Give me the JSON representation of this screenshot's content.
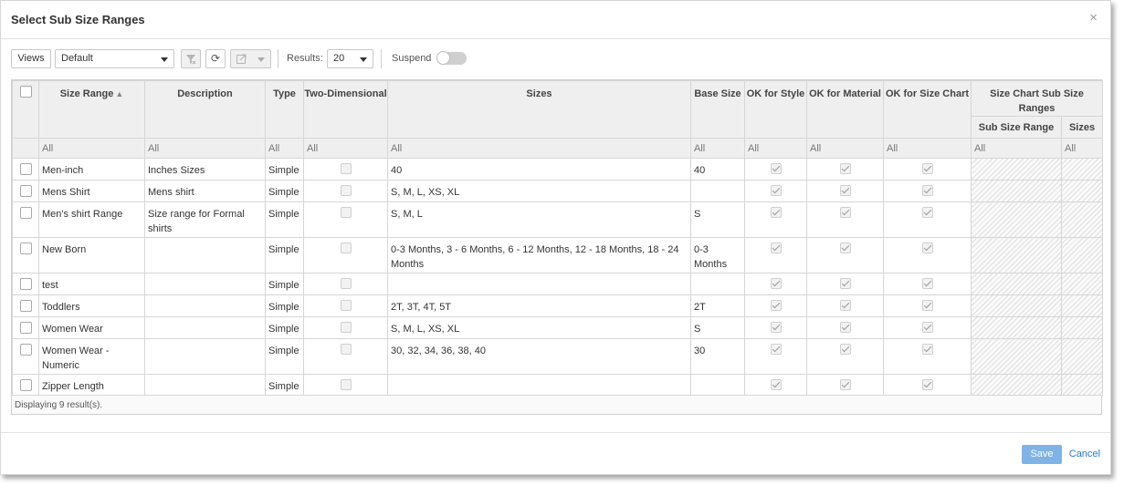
{
  "dialog": {
    "title": "Select Sub Size Ranges",
    "close": "×"
  },
  "toolbar": {
    "views_label": "Views",
    "view_selected": "Default",
    "refresh_symbol": "⟳",
    "results_label": "Results:",
    "results_value": "20",
    "suspend_label": "Suspend"
  },
  "grid": {
    "headers": {
      "size_range": "Size Range",
      "description": "Description",
      "type": "Type",
      "two_dim": "Two-Dimensional",
      "sizes": "Sizes",
      "base_size": "Base Size",
      "ok_style": "OK for Style",
      "ok_material": "OK for Material",
      "ok_size_chart": "OK for Size Chart",
      "group": "Size Chart Sub Size Ranges",
      "sub_size_range": "Sub Size Range",
      "sub_sizes": "Sizes"
    },
    "filter_all": "All",
    "rows": [
      {
        "size_range": "Men-inch",
        "description": "Inches Sizes",
        "type": "Simple",
        "sizes": "40",
        "base_size": "40"
      },
      {
        "size_range": "Mens Shirt",
        "description": "Mens shirt",
        "type": "Simple",
        "sizes": "S, M, L, XS, XL",
        "base_size": ""
      },
      {
        "size_range": "Men's shirt Range",
        "description": "Size range for Formal shirts",
        "type": "Simple",
        "sizes": "S, M, L",
        "base_size": "S"
      },
      {
        "size_range": "New Born",
        "description": "",
        "type": "Simple",
        "sizes": "0-3 Months, 3 - 6 Months, 6 - 12 Months, 12 - 18 Months, 18 - 24 Months",
        "base_size": "0-3 Months"
      },
      {
        "size_range": "test",
        "description": "",
        "type": "Simple",
        "sizes": "",
        "base_size": ""
      },
      {
        "size_range": "Toddlers",
        "description": "",
        "type": "Simple",
        "sizes": "2T, 3T, 4T, 5T",
        "base_size": "2T"
      },
      {
        "size_range": "Women Wear",
        "description": "",
        "type": "Simple",
        "sizes": "S, M, L, XS, XL",
        "base_size": "S"
      },
      {
        "size_range": "Women Wear - Numeric",
        "description": "",
        "type": "Simple",
        "sizes": "30, 32, 34, 36, 38, 40",
        "base_size": "30"
      },
      {
        "size_range": "Zipper Length",
        "description": "",
        "type": "Simple",
        "sizes": "",
        "base_size": ""
      }
    ],
    "footer": "Displaying 9 result(s)."
  },
  "actions": {
    "save": "Save",
    "cancel": "Cancel"
  },
  "colors": {
    "primary": "#7fb3e6",
    "link": "#2a78c8"
  }
}
